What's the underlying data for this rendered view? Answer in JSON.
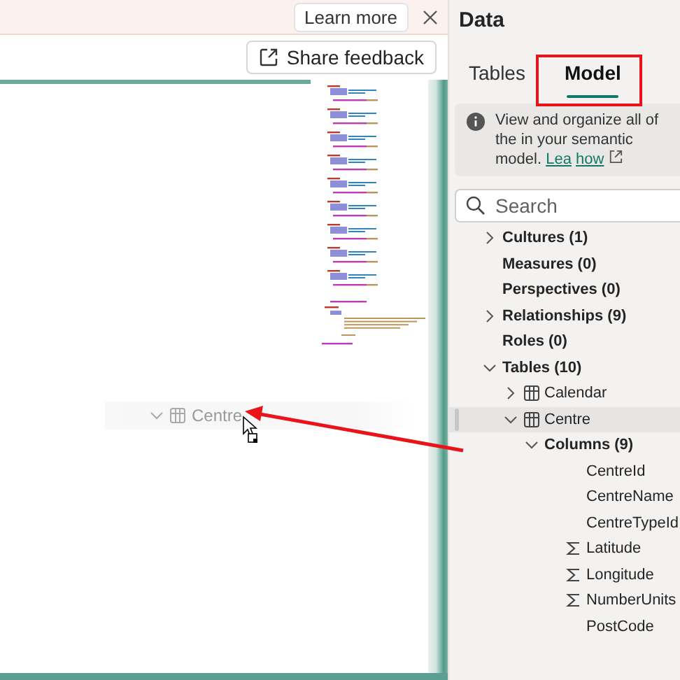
{
  "banner": {
    "button": "Learn more"
  },
  "toolbar": {
    "button": "Share feedback"
  },
  "editor": {
    "drag_preview": {
      "label": "Centre"
    }
  },
  "data_panel": {
    "title": "Data",
    "tabs": [
      {
        "label": "Tables",
        "selected": false
      },
      {
        "label": "Model",
        "selected": true
      }
    ],
    "info": {
      "text": "View and organize all of the in your semantic model.",
      "link_parts": [
        "Lea",
        "how"
      ]
    },
    "search": {
      "placeholder": "Search"
    },
    "tree": [
      {
        "label": "Cultures (1)",
        "kind": "group",
        "expanded": false,
        "selected": false
      },
      {
        "label": "Measures (0)",
        "kind": "group",
        "selected": false
      },
      {
        "label": "Perspectives (0)",
        "kind": "group",
        "selected": false
      },
      {
        "label": "Relationships (9)",
        "kind": "group",
        "expanded": false,
        "selected": false
      },
      {
        "label": "Roles (0)",
        "kind": "group",
        "selected": false
      },
      {
        "label": "Tables (10)",
        "kind": "group",
        "expanded": true,
        "selected": false,
        "children": [
          {
            "label": "Calendar",
            "kind": "table",
            "expanded": false,
            "selected": false
          },
          {
            "label": "Centre",
            "kind": "table",
            "expanded": true,
            "selected": true,
            "children": [
              {
                "label": "Columns (9)",
                "kind": "group",
                "expanded": true,
                "selected": false,
                "children": [
                  {
                    "label": "CentreId",
                    "kind": "column",
                    "selected": false
                  },
                  {
                    "label": "CentreName",
                    "kind": "column",
                    "selected": false
                  },
                  {
                    "label": "CentreTypeId",
                    "kind": "column",
                    "selected": false
                  },
                  {
                    "label": "Latitude",
                    "kind": "numeric",
                    "selected": false
                  },
                  {
                    "label": "Longitude",
                    "kind": "numeric",
                    "selected": false
                  },
                  {
                    "label": "NumberUnits",
                    "kind": "numeric",
                    "selected": false
                  },
                  {
                    "label": "PostCode",
                    "kind": "column",
                    "selected": false
                  }
                ]
              }
            ]
          }
        ]
      }
    ]
  }
}
